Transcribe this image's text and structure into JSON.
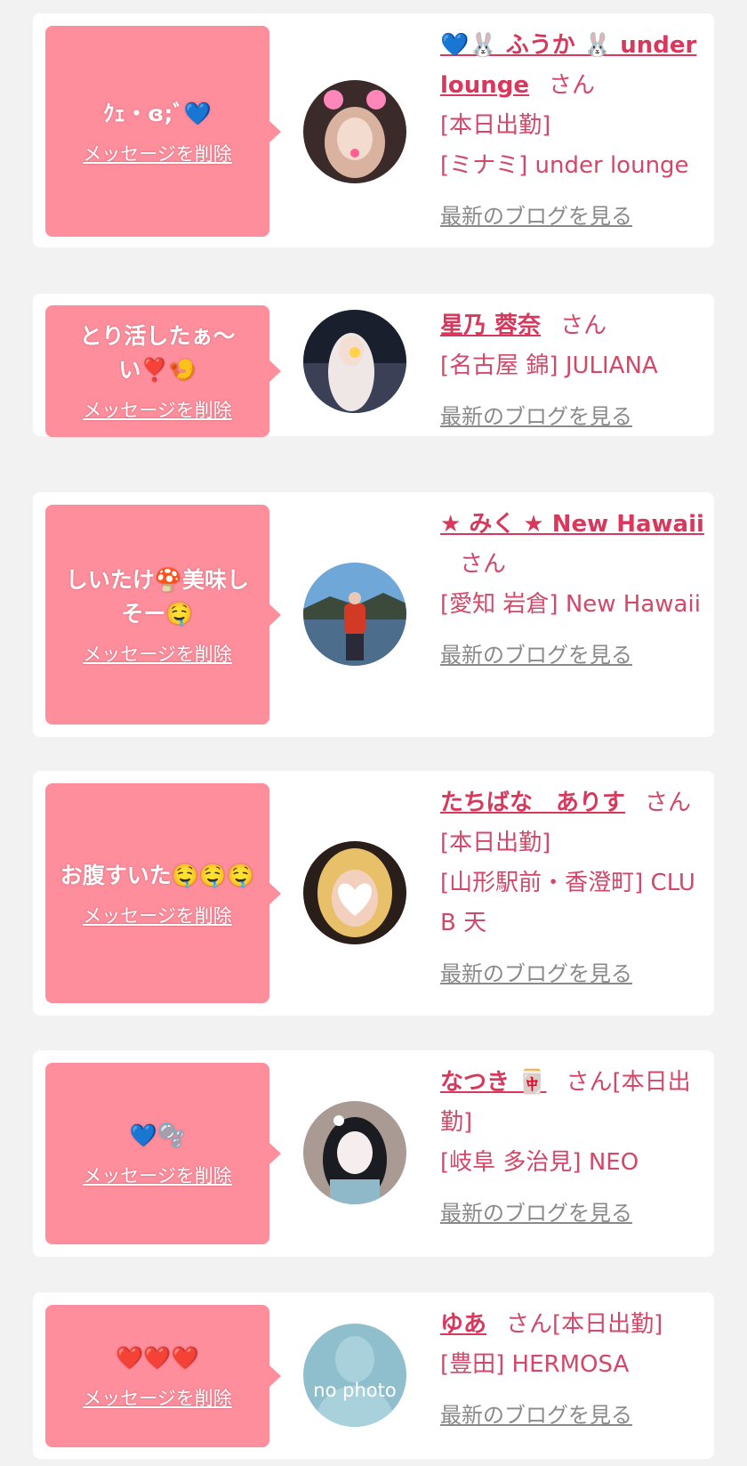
{
  "delete_label": "メッセージを削除",
  "blog_label": "最新のブログを見る",
  "honorific": "さん",
  "cards": [
    {
      "message": "ｸｪ・ɞ;ﾞ💙",
      "name": "💙🐰 ふうか 🐰 under lounge",
      "badge": "[本日出勤]",
      "shop": "[ミナミ] under lounge",
      "avatar": "photo-girl-pink-bows"
    },
    {
      "message": "とり活したぁ〜い❣️🍤",
      "name": "星乃 蓉奈",
      "badge": "",
      "shop": "[名古屋 錦] JULIANA",
      "avatar": "photo-girl-night"
    },
    {
      "message": "しいたけ🍄美味しそー🤤",
      "name": "★ みく ★ New Hawaii",
      "badge": "",
      "shop": "[愛知 岩倉] New Hawaii",
      "avatar": "photo-fishing-lake"
    },
    {
      "message": "お腹すいた🤤🤤🤤",
      "name": "たちばな　ありす",
      "badge": "[本日出勤]",
      "shop": "[山形駅前・香澄町] CLUB 天",
      "avatar": "photo-blonde-heart"
    },
    {
      "message": "💙🫧",
      "name": "なつき 🀄",
      "badge": "[本日出勤]",
      "shop": "[岐阜 多治見] NEO",
      "avatar": "photo-girl-mask"
    },
    {
      "message": "❤️❤️❤️",
      "name": "ゆあ",
      "badge": "[本日出勤]",
      "shop": "[豊田] HERMOSA",
      "avatar": "no-photo",
      "avatar_text": "no photo"
    }
  ],
  "colors": {
    "bubble": "#ff8e9d",
    "name": "#d8385c",
    "text": "#d24868",
    "link_gray": "#8a8a8a",
    "page_bg": "#f2f2f2"
  }
}
